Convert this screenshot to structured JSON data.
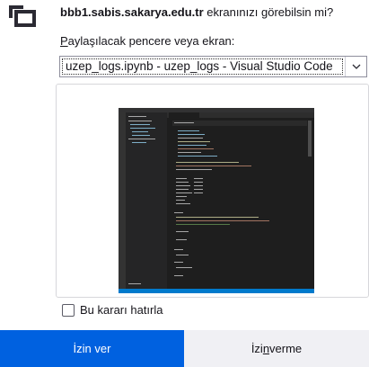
{
  "dialog": {
    "title_host": "bbb1.sabis.sakarya.edu.tr",
    "title_rest": " ekranınızı görebilsin mi?",
    "select_label_mnemonic": "P",
    "select_label_rest": "aylaşılacak pencere veya ekran:",
    "selected_window": "uzep_logs.ipynb - uzep_logs - Visual Studio Code",
    "remember_label": "Bu kararı hatırla",
    "allow_button": "İzin ver",
    "deny_button_pre": "İzi",
    "deny_button_mnemonic": "n",
    "deny_button_post": " verme"
  },
  "colors": {
    "allow_bg": "#0061e0",
    "deny_bg": "#f0f0f4",
    "preview_bg": "#1e1e1e"
  },
  "icons": {
    "share": "screen-share-icon",
    "select_arrow": "chevron-down-icon"
  }
}
